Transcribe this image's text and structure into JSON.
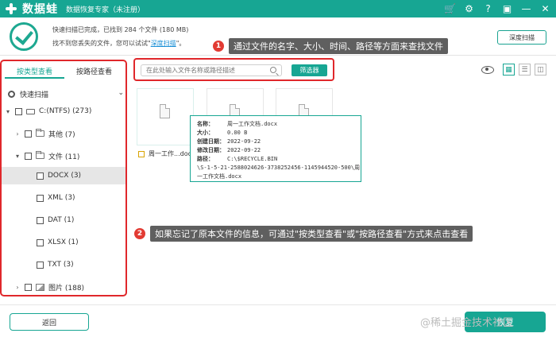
{
  "app": {
    "name": "数据蛙",
    "edition": "数据恢复专家（未注册）"
  },
  "window_controls": [
    "cart-icon",
    "settings-icon",
    "help-icon",
    "save-icon",
    "minimize-icon",
    "close-icon"
  ],
  "status": {
    "line1": "快速扫描已完成，已找到  284 个文件 (180 MB)",
    "line2_prefix": "找不到您丢失的文件，您可以试试\"",
    "line2_link": "深度扫描",
    "line2_suffix": "\"。",
    "deep_scan_button": "深度扫描"
  },
  "callouts": [
    {
      "number": "1",
      "text": "通过文件的名字、大小、时间、路径等方面来查找文件"
    },
    {
      "number": "2",
      "text": "如果忘记了原本文件的信息，可通过\"按类型查看\"或\"按路径查看\"方式来点击查看"
    }
  ],
  "sidebar": {
    "tabs": [
      {
        "label": "按类型查看",
        "active": true
      },
      {
        "label": "按路径查看",
        "active": false
      }
    ],
    "scan_mode": "快速扫描",
    "tree": [
      {
        "label": "C:(NTFS) (273)",
        "level": 0,
        "toggle": "▾",
        "icon": "drive"
      },
      {
        "label": "其他 (7)",
        "level": 1,
        "toggle": "›",
        "icon": "folder"
      },
      {
        "label": "文件 (11)",
        "level": 1,
        "toggle": "▾",
        "icon": "folder"
      },
      {
        "label": "DOCX (3)",
        "level": 2,
        "selected": true
      },
      {
        "label": "XML (3)",
        "level": 2
      },
      {
        "label": "DAT (1)",
        "level": 2
      },
      {
        "label": "XLSX (1)",
        "level": 2
      },
      {
        "label": "TXT (3)",
        "level": 2
      },
      {
        "label": "图片 (188)",
        "level": 1,
        "toggle": "›",
        "icon": "image"
      }
    ]
  },
  "search": {
    "placeholder": "在此处输入文件名称或路径描述",
    "filter_button": "筛选器"
  },
  "files": [
    {
      "name": "周一工作...docx"
    }
  ],
  "tooltip": {
    "name_label": "名称：",
    "name": "周一工作文档.docx",
    "size_label": "大小：",
    "size": "0.00 B",
    "created_label": "创建日期：",
    "created": "2022-09-22",
    "modified_label": "修改日期：",
    "modified": "2022-09-22",
    "path_label": "路径：",
    "path1": "C:\\$RECYCLE.BIN",
    "path2": "\\S-1-5-21-2588024626-3738252456-1145944520-500\\周",
    "path3": "一工作文档.docx"
  },
  "bottom": {
    "back_button": "返回",
    "recover_button": "恢复"
  },
  "watermark": "@稀土掘金技术社区",
  "colors": {
    "accent": "#17a693",
    "callout_red": "#e0272b",
    "link": "#1a8fd6"
  }
}
